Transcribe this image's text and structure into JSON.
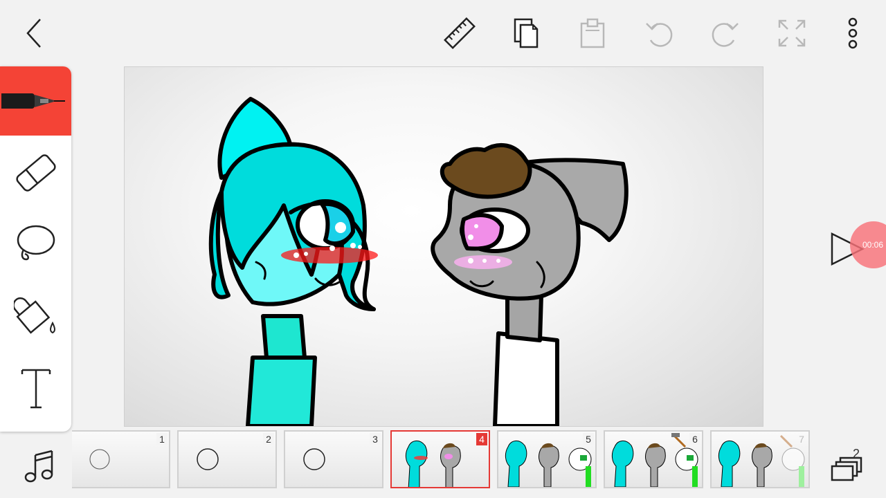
{
  "toolbar": {
    "back": "back-icon",
    "ruler": "ruler-icon",
    "copy": "copy-icon",
    "paste": "paste-icon",
    "undo": "undo-icon",
    "redo": "redo-icon",
    "fullscreen": "fullscreen-icon",
    "more": "more-vertical-icon"
  },
  "tools": [
    {
      "name": "pen",
      "icon": "pen-icon",
      "active": true
    },
    {
      "name": "eraser",
      "icon": "eraser-icon",
      "active": false
    },
    {
      "name": "lasso",
      "icon": "lasso-icon",
      "active": false
    },
    {
      "name": "fill",
      "icon": "fill-bucket-icon",
      "active": false
    },
    {
      "name": "text",
      "icon": "text-icon",
      "active": false
    }
  ],
  "playback": {
    "timer": "00:06"
  },
  "frames": [
    {
      "number": "1",
      "selected": false
    },
    {
      "number": "2",
      "selected": false
    },
    {
      "number": "3",
      "selected": false
    },
    {
      "number": "4",
      "selected": true
    },
    {
      "number": "5",
      "selected": false
    },
    {
      "number": "6",
      "selected": false
    },
    {
      "number": "7",
      "selected": false
    }
  ],
  "layers": {
    "count": "2"
  },
  "colors": {
    "accent": "#f44336",
    "timer_bg": "#f87179",
    "character1": "#00e5e8",
    "character2": "#a8a8a8",
    "blush_red": "#e53935",
    "blush_pink": "#f3a6e6"
  }
}
